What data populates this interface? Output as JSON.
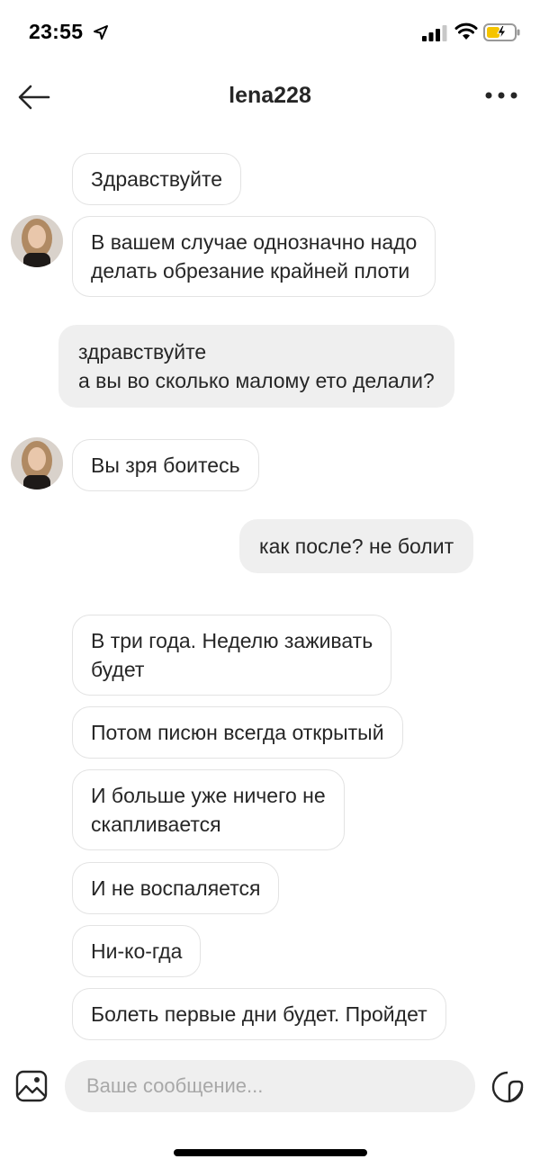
{
  "status_bar": {
    "time": "23:55",
    "location_icon": "location-arrow-icon",
    "signal_icon": "cellular-signal-icon",
    "wifi_icon": "wifi-icon",
    "battery_icon": "battery-charging-icon",
    "battery_color": "#f5c400"
  },
  "header": {
    "title": "lena228",
    "back_icon": "arrow-left-icon",
    "more_icon": "more-horizontal-icon"
  },
  "messages": [
    {
      "side": "in",
      "text": "Здравствуйте"
    },
    {
      "side": "in",
      "text": "В вашем случае однозначно надо\nделать обрезание крайней плоти",
      "avatar": true
    },
    {
      "side": "out",
      "text": "здравствуйте\nа вы во сколько малому ето делали?"
    },
    {
      "side": "in",
      "text": "Вы зря боитесь",
      "avatar": true
    },
    {
      "side": "out",
      "text": "как после?  не болит"
    },
    {
      "side": "in",
      "text": "В три года. Неделю заживать\nбудет"
    },
    {
      "side": "in",
      "text": "Потом писюн всегда открытый"
    },
    {
      "side": "in",
      "text": "И больше уже ничего не\nскапливается"
    },
    {
      "side": "in",
      "text": "И не воспаляется"
    },
    {
      "side": "in",
      "text": "Ни-ко-гда"
    },
    {
      "side": "in",
      "text": "Болеть первые дни будет. Пройдет"
    }
  ],
  "composer": {
    "placeholder": "Ваше сообщение...",
    "gallery_icon": "image-gallery-icon",
    "sticker_icon": "sticker-icon"
  },
  "colors": {
    "outgoing_bubble": "#efefef",
    "incoming_border": "#e3e3e3",
    "text": "#262626"
  }
}
